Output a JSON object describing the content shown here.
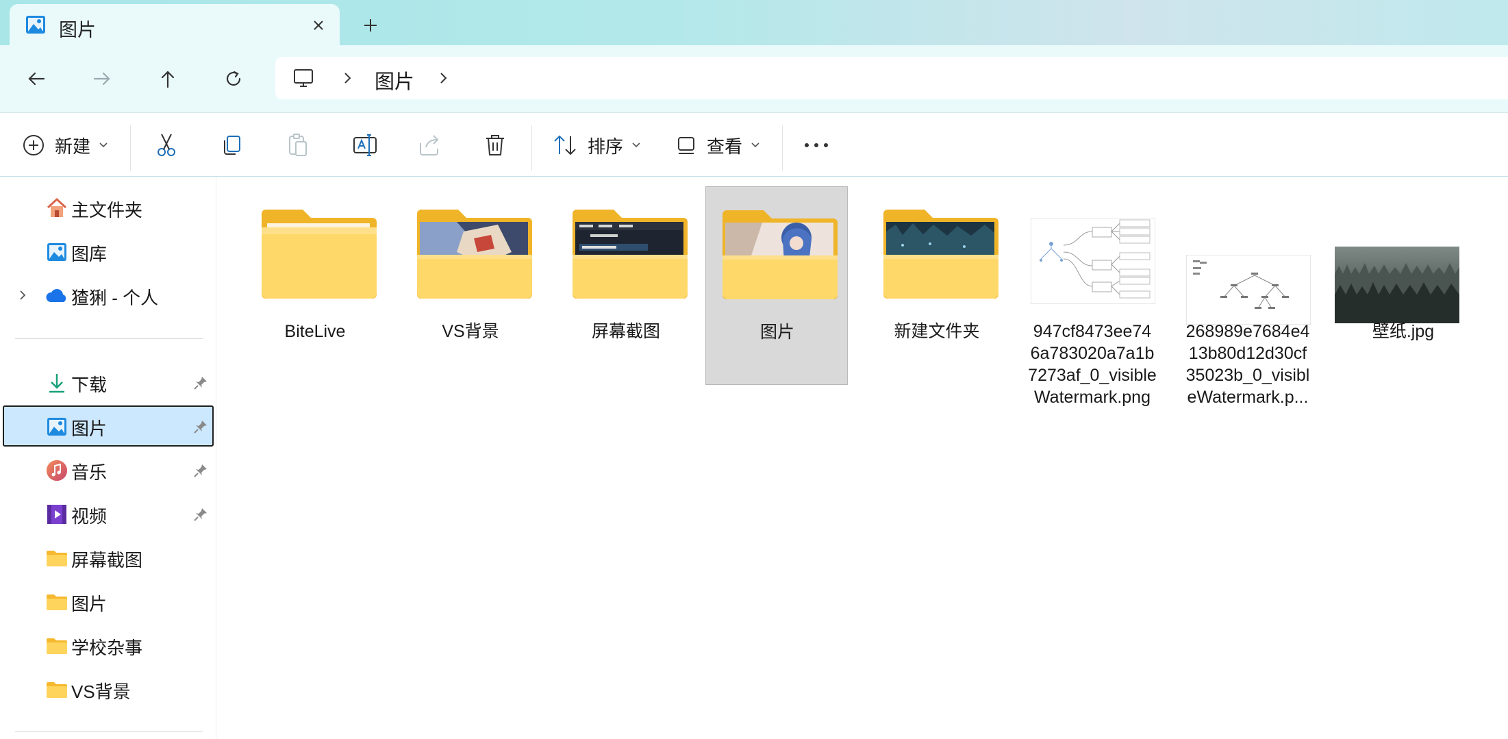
{
  "window": {
    "tab_title": "图片",
    "tab_icon": "pictures-icon"
  },
  "nav": {
    "back_icon": "arrow-left-icon",
    "forward_icon": "arrow-right-icon",
    "up_icon": "arrow-up-icon",
    "refresh_icon": "refresh-icon",
    "breadcrumb": [
      "图片"
    ]
  },
  "toolbar": {
    "new_label": "新建",
    "sort_label": "排序",
    "view_label": "查看",
    "icons": [
      "plus-circle-icon",
      "cut-icon",
      "copy-icon",
      "paste-icon",
      "rename-icon",
      "share-icon",
      "delete-icon",
      "sort-icon",
      "view-icon",
      "more-icon"
    ]
  },
  "sidebar": {
    "items": [
      {
        "label": "主文件夹",
        "icon": "home-icon",
        "pinned": false,
        "expandable": false
      },
      {
        "label": "图库",
        "icon": "gallery-icon",
        "pinned": false,
        "expandable": false
      },
      {
        "label": "猹猁 - 个人",
        "icon": "onedrive-cloud-icon",
        "pinned": false,
        "expandable": true
      }
    ],
    "quick_access": [
      {
        "label": "下载",
        "icon": "download-icon",
        "pinned": true
      },
      {
        "label": "图片",
        "icon": "pictures-icon",
        "pinned": true,
        "selected": true
      },
      {
        "label": "音乐",
        "icon": "music-icon",
        "pinned": true
      },
      {
        "label": "视频",
        "icon": "video-icon",
        "pinned": true
      },
      {
        "label": "屏幕截图",
        "icon": "folder-icon",
        "pinned": false
      },
      {
        "label": "图片",
        "icon": "folder-icon",
        "pinned": false
      },
      {
        "label": "学校杂事",
        "icon": "folder-icon",
        "pinned": false
      },
      {
        "label": "VS背景",
        "icon": "folder-icon",
        "pinned": false
      }
    ]
  },
  "files": [
    {
      "name": "BiteLive",
      "kind": "folder",
      "preview": "empty"
    },
    {
      "name": "VS背景",
      "kind": "folder",
      "preview": "anime-art"
    },
    {
      "name": "屏幕截图",
      "kind": "folder",
      "preview": "screenshot"
    },
    {
      "name": "图片",
      "kind": "folder",
      "preview": "anime-blue-hair",
      "selected": true
    },
    {
      "name": "新建文件夹",
      "kind": "folder",
      "preview": "night-forest"
    },
    {
      "name": "947cf8473ee746a783020a7a1b7273af_0_visibleWatermark.png",
      "display_lines": [
        "947cf8473ee74",
        "6a783020a7a1b",
        "7273af_0_visible",
        "Watermark.png"
      ],
      "kind": "image",
      "preview": "mind-map"
    },
    {
      "name": "268989e7684e413b80d12d30cf35023b_0_visibleWatermark.p...",
      "display_lines": [
        "268989e7684e4",
        "13b80d12d30cf",
        "35023b_0_visibl",
        "eWatermark.p..."
      ],
      "kind": "image",
      "preview": "tree-diagram"
    },
    {
      "name": "壁纸.jpg",
      "display_lines": [
        "壁纸.jpg"
      ],
      "kind": "image",
      "preview": "misty-forest"
    }
  ],
  "colors": {
    "accent": "#0067c0",
    "selection": "#cce8ff",
    "folder_yellow": "#ffc83d",
    "tab_bg": "#a8e6e8"
  }
}
